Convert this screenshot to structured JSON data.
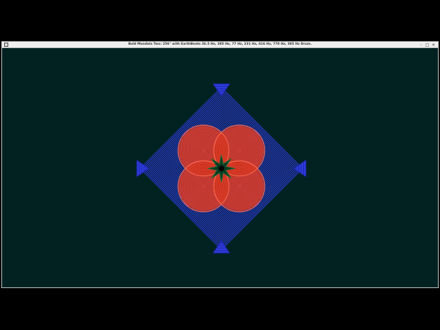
{
  "window": {
    "title": "Bold Mandala Two: 256° with EarthBeats 36.5 Hz, 385 Hz, 77 Hz, 231 Hz, 616 Hz, 770 Hz, 385 Hz Drum.",
    "minimize_glyph": "–",
    "maximize_glyph": "□",
    "close_glyph": "×"
  },
  "colors": {
    "background": "#022222",
    "diamond": "#2d3bdb",
    "flower": "#e8402a",
    "center": "#0a3a22"
  },
  "icons": {
    "app": "app-icon",
    "minimize": "minimize-icon",
    "maximize": "maximize-icon",
    "close": "close-icon"
  }
}
